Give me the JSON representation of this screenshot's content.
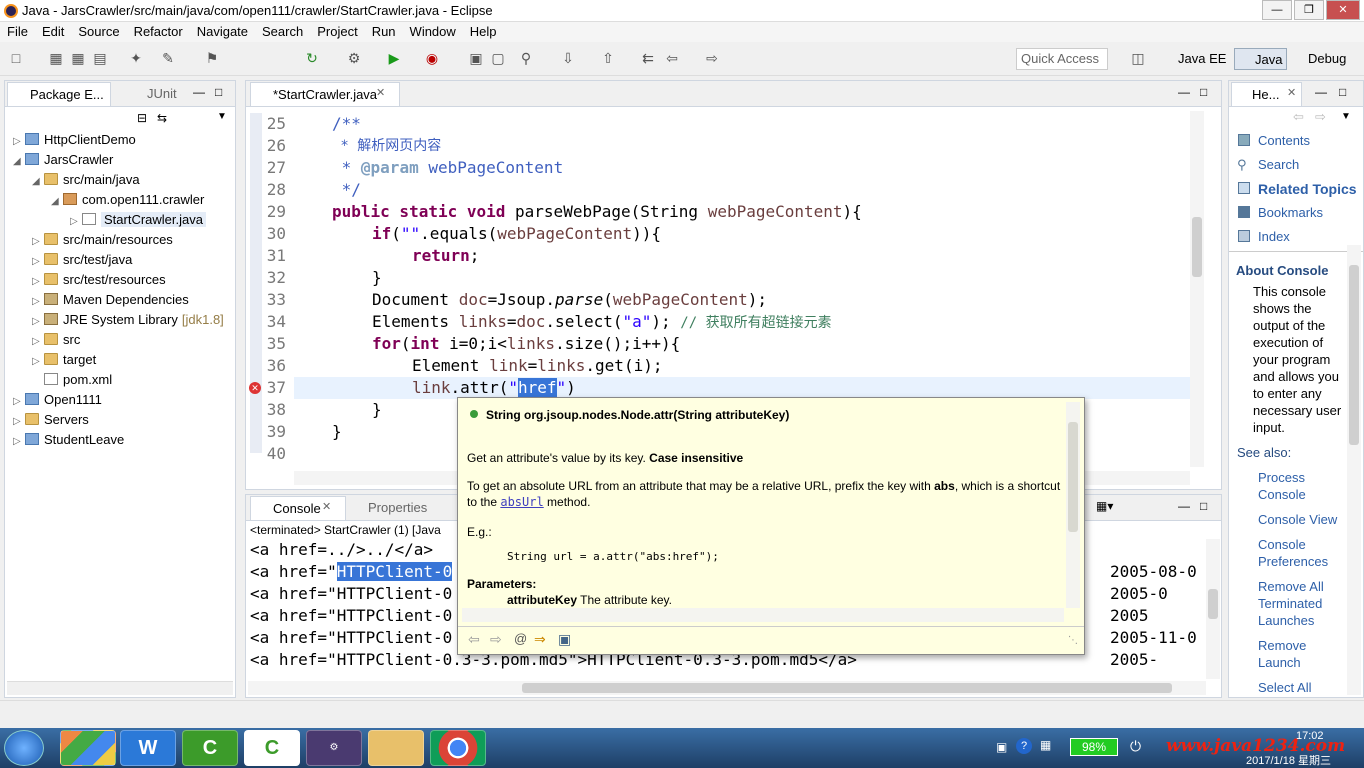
{
  "window": {
    "title": "Java - JarsCrawler/src/main/java/com/open111/crawler/StartCrawler.java - Eclipse"
  },
  "menu": [
    "File",
    "Edit",
    "Source",
    "Refactor",
    "Navigate",
    "Search",
    "Project",
    "Run",
    "Window",
    "Help"
  ],
  "toolbar": {
    "quick_access_placeholder": "Quick Access",
    "perspectives": [
      "Java EE",
      "Java",
      "Debug"
    ]
  },
  "package_explorer": {
    "tabs": [
      "Package E...",
      "JUnit"
    ],
    "items": [
      {
        "label": "HttpClientDemo",
        "level": 0,
        "type": "proj"
      },
      {
        "label": "JarsCrawler",
        "level": 0,
        "type": "proj",
        "expanded": true
      },
      {
        "label": "src/main/java",
        "level": 1,
        "type": "folder",
        "expanded": true
      },
      {
        "label": "com.open111.crawler",
        "level": 2,
        "type": "pkg",
        "expanded": true
      },
      {
        "label": "StartCrawler.java",
        "level": 3,
        "type": "file",
        "selected": true
      },
      {
        "label": "src/main/resources",
        "level": 1,
        "type": "folder"
      },
      {
        "label": "src/test/java",
        "level": 1,
        "type": "folder"
      },
      {
        "label": "src/test/resources",
        "level": 1,
        "type": "folder"
      },
      {
        "label": "Maven Dependencies",
        "level": 1,
        "type": "jar"
      },
      {
        "label": "JRE System Library",
        "level": 1,
        "type": "jar",
        "suffix": "[jdk1.8]"
      },
      {
        "label": "src",
        "level": 1,
        "type": "folder"
      },
      {
        "label": "target",
        "level": 1,
        "type": "folder"
      },
      {
        "label": "pom.xml",
        "level": 1,
        "type": "file"
      },
      {
        "label": "Open1111",
        "level": 0,
        "type": "proj"
      },
      {
        "label": "Servers",
        "level": 0,
        "type": "folder"
      },
      {
        "label": "StudentLeave",
        "level": 0,
        "type": "proj"
      }
    ]
  },
  "editor": {
    "tab": "*StartCrawler.java",
    "line_numbers": [
      "25",
      "26",
      "27",
      "28",
      "29",
      "30",
      "31",
      "32",
      "33",
      "34",
      "35",
      "36",
      "37",
      "38",
      "39",
      "40"
    ],
    "l25": "/**",
    "l26": " * 解析网页内容",
    "l27a": " * ",
    "l27b": "@param",
    "l27c": " webPageContent",
    "l28": " */",
    "l29a": "public static void",
    "l29b": " parseWebPage(String ",
    "l29c": "webPageContent",
    "l29d": "){",
    "l30a": "if",
    "l30b": "(",
    "l30c": "\"\"",
    "l30d": ".equals(",
    "l30e": "webPageContent",
    "l30f": ")){",
    "l31a": "return",
    "l31b": ";",
    "l32": "}",
    "l33a": "Document ",
    "l33b": "doc",
    "l33c": "=Jsoup.",
    "l33d": "parse",
    "l33e": "(",
    "l33f": "webPageContent",
    "l33g": ");",
    "l34a": "Elements ",
    "l34b": "links",
    "l34c": "=",
    "l34d": "doc",
    "l34e": ".select(",
    "l34f": "\"a\"",
    "l34g": "); ",
    "l34h": "// 获取所有超链接元素",
    "l35a": "for",
    "l35b": "(",
    "l35c": "int",
    "l35d": " i=0;i<",
    "l35e": "links",
    "l35f": ".size();i++){",
    "l36a": "Element ",
    "l36b": "link",
    "l36c": "=",
    "l36d": "links",
    "l36e": ".get(i);",
    "l37a": "link",
    "l37b": ".attr(",
    "l37c": "\"",
    "l37d": "href",
    "l37e": "\"",
    "l37f": ")",
    "l38": "}",
    "l39": "}"
  },
  "console": {
    "tabs": [
      "Console",
      "Properties"
    ],
    "status": "<terminated> StartCrawler (1) [Java",
    "lines": [
      {
        "left": "<a href=../>../</a>",
        "right": ""
      },
      {
        "left": "<a href=\"",
        "sel": "HTTPClient-0",
        "right": "2005-08-0"
      },
      {
        "left": "<a href=\"HTTPClient-0",
        "right": "2005-0"
      },
      {
        "left": "<a href=\"HTTPClient-0",
        "right": "2005"
      },
      {
        "left": "<a href=\"HTTPClient-0",
        "right": "2005-11-0"
      },
      {
        "left": "<a href=\"HTTPClient-0.3-3.pom.md5\">HTTPClient-0.3-3.pom.md5</a>",
        "right": "2005-"
      }
    ]
  },
  "hover": {
    "signature": "String org.jsoup.nodes.Node.attr(String attributeKey)",
    "desc_a": "Get an attribute's value by its key. ",
    "desc_b": "Case insensitive",
    "p2a": "To get an absolute URL from an attribute that may be a relative URL, prefix the key with ",
    "p2b": "abs",
    "p2c": ", which is a shortcut to the ",
    "p2d": "absUrl",
    "p2e": " method.",
    "eg": "E.g.:",
    "code": "String url = a.attr(\"abs:href\");",
    "params_title": "Parameters:",
    "param_name": "attributeKey",
    "param_desc": " The attribute key."
  },
  "help": {
    "tab": "He...",
    "links": [
      "Contents",
      "Search",
      "Related Topics",
      "Bookmarks",
      "Index"
    ],
    "about_title": "About Console",
    "about_text": "This console shows the output of the execution of your program and allows you to enter any necessary user input.",
    "see_also": "See also:",
    "see_links": [
      "Process Console",
      "Console View",
      "Console Preferences",
      "Remove All Terminated Launches",
      "Remove Launch",
      "Select All"
    ]
  },
  "taskbar": {
    "battery": "98%",
    "watermark": "www.java1234.com",
    "date": "2017/1/18 星期三",
    "time": "17:02"
  }
}
